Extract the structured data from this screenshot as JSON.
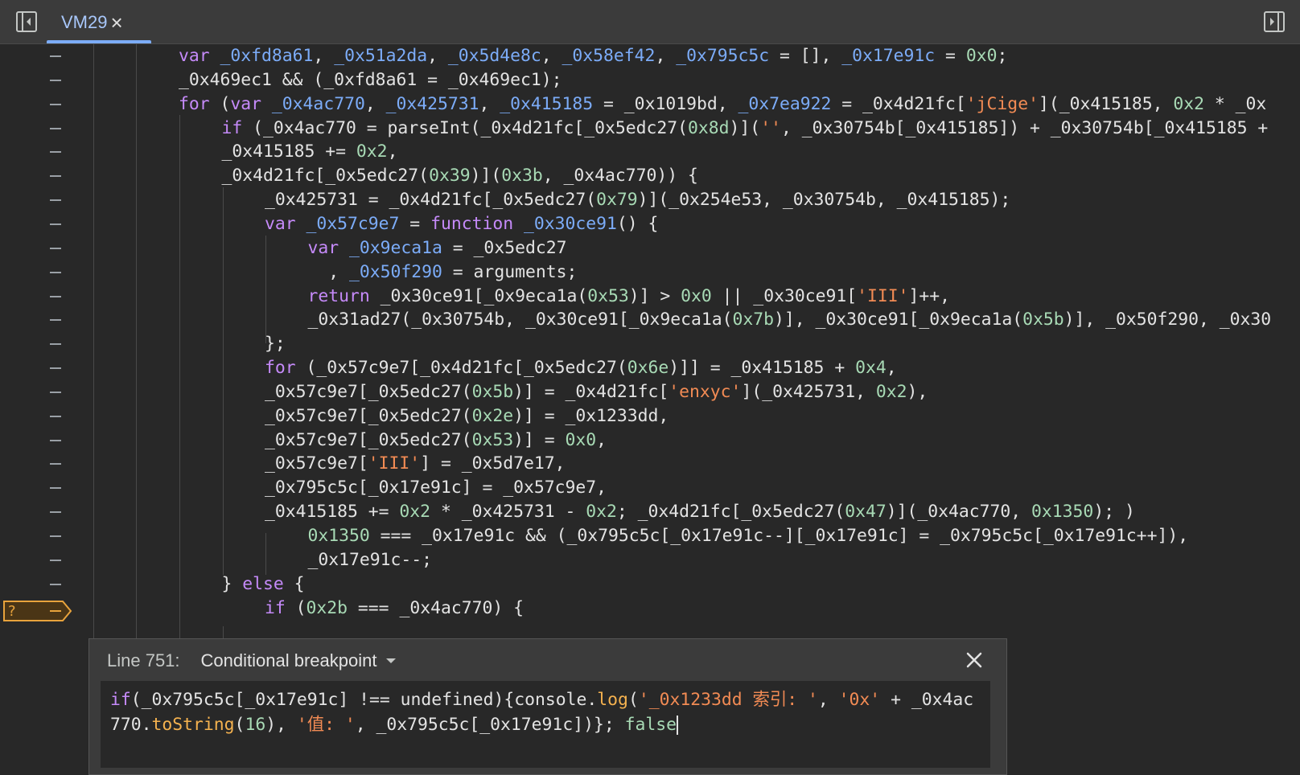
{
  "tab": {
    "title": "VM29",
    "close": "×"
  },
  "editor": {
    "lines": [
      {
        "indent": 0,
        "tokens": [
          [
            "k",
            "var "
          ],
          [
            "v",
            "_0xfd8a61"
          ],
          [
            "p",
            ", "
          ],
          [
            "v",
            "_0x51a2da"
          ],
          [
            "p",
            ", "
          ],
          [
            "v",
            "_0x5d4e8c"
          ],
          [
            "p",
            ", "
          ],
          [
            "v",
            "_0x58ef42"
          ],
          [
            "p",
            ", "
          ],
          [
            "v",
            "_0x795c5c"
          ],
          [
            "p",
            " = [], "
          ],
          [
            "v",
            "_0x17e91c"
          ],
          [
            "p",
            " = "
          ],
          [
            "n",
            "0x0"
          ],
          [
            "p",
            ";"
          ]
        ]
      },
      {
        "indent": 0,
        "tokens": [
          [
            "p",
            "_0x469ec1 && (_0xfd8a61 = _0x469ec1);"
          ]
        ]
      },
      {
        "indent": 0,
        "tokens": [
          [
            "k",
            "for "
          ],
          [
            "p",
            "("
          ],
          [
            "k",
            "var "
          ],
          [
            "v",
            "_0x4ac770"
          ],
          [
            "p",
            ", "
          ],
          [
            "v",
            "_0x425731"
          ],
          [
            "p",
            ", "
          ],
          [
            "v",
            "_0x415185"
          ],
          [
            "p",
            " = _0x1019bd, "
          ],
          [
            "v",
            "_0x7ea922"
          ],
          [
            "p",
            " = _0x4d21fc["
          ],
          [
            "s",
            "'jCige'"
          ],
          [
            "p",
            "](_0x415185, "
          ],
          [
            "n",
            "0x2"
          ],
          [
            "p",
            " * _0x"
          ]
        ]
      },
      {
        "indent": 1,
        "tokens": [
          [
            "k",
            "if "
          ],
          [
            "p",
            "(_0x4ac770 = parseInt(_0x4d21fc[_0x5edc27("
          ],
          [
            "n",
            "0x8d"
          ],
          [
            "p",
            ")]("
          ],
          [
            "s",
            "''"
          ],
          [
            "p",
            ", _0x30754b[_0x415185]) + _0x30754b[_0x415185 + "
          ]
        ]
      },
      {
        "indent": 1,
        "tokens": [
          [
            "p",
            "_0x415185 += "
          ],
          [
            "n",
            "0x2"
          ],
          [
            "p",
            ","
          ]
        ]
      },
      {
        "indent": 1,
        "tokens": [
          [
            "p",
            "_0x4d21fc[_0x5edc27("
          ],
          [
            "n",
            "0x39"
          ],
          [
            "p",
            ")]("
          ],
          [
            "n",
            "0x3b"
          ],
          [
            "p",
            ", _0x4ac770)) {"
          ]
        ]
      },
      {
        "indent": 2,
        "tokens": [
          [
            "p",
            "_0x425731 = _0x4d21fc[_0x5edc27("
          ],
          [
            "n",
            "0x79"
          ],
          [
            "p",
            ")](_0x254e53, _0x30754b, _0x415185);"
          ]
        ]
      },
      {
        "indent": 2,
        "tokens": [
          [
            "k",
            "var "
          ],
          [
            "v",
            "_0x57c9e7"
          ],
          [
            "p",
            " = "
          ],
          [
            "k",
            "function "
          ],
          [
            "v",
            "_0x30ce91"
          ],
          [
            "p",
            "() {"
          ]
        ]
      },
      {
        "indent": 3,
        "tokens": [
          [
            "k",
            "var "
          ],
          [
            "v",
            "_0x9eca1a"
          ],
          [
            "p",
            " = _0x5edc27"
          ]
        ]
      },
      {
        "indent": 3,
        "tokens": [
          [
            "p",
            "  , "
          ],
          [
            "v",
            "_0x50f290"
          ],
          [
            "p",
            " = arguments;"
          ]
        ]
      },
      {
        "indent": 3,
        "tokens": [
          [
            "k",
            "return "
          ],
          [
            "p",
            "_0x30ce91[_0x9eca1a("
          ],
          [
            "n",
            "0x53"
          ],
          [
            "p",
            ")] > "
          ],
          [
            "n",
            "0x0"
          ],
          [
            "p",
            " || _0x30ce91["
          ],
          [
            "s",
            "'III'"
          ],
          [
            "p",
            "]++,"
          ]
        ]
      },
      {
        "indent": 3,
        "tokens": [
          [
            "p",
            "_0x31ad27(_0x30754b, _0x30ce91[_0x9eca1a("
          ],
          [
            "n",
            "0x7b"
          ],
          [
            "p",
            ")], _0x30ce91[_0x9eca1a("
          ],
          [
            "n",
            "0x5b"
          ],
          [
            "p",
            ")], _0x50f290, _0x30"
          ]
        ]
      },
      {
        "indent": 2,
        "tokens": [
          [
            "p",
            "};"
          ]
        ]
      },
      {
        "indent": 2,
        "tokens": [
          [
            "k",
            "for "
          ],
          [
            "p",
            "(_0x57c9e7[_0x4d21fc[_0x5edc27("
          ],
          [
            "n",
            "0x6e"
          ],
          [
            "p",
            ")]] = _0x415185 + "
          ],
          [
            "n",
            "0x4"
          ],
          [
            "p",
            ","
          ]
        ]
      },
      {
        "indent": 2,
        "tokens": [
          [
            "p",
            "_0x57c9e7[_0x5edc27("
          ],
          [
            "n",
            "0x5b"
          ],
          [
            "p",
            ")] = _0x4d21fc["
          ],
          [
            "s",
            "'enxyc'"
          ],
          [
            "p",
            "](_0x425731, "
          ],
          [
            "n",
            "0x2"
          ],
          [
            "p",
            "),"
          ]
        ]
      },
      {
        "indent": 2,
        "tokens": [
          [
            "p",
            "_0x57c9e7[_0x5edc27("
          ],
          [
            "n",
            "0x2e"
          ],
          [
            "p",
            ")] = _0x1233dd,"
          ]
        ]
      },
      {
        "indent": 2,
        "tokens": [
          [
            "p",
            "_0x57c9e7[_0x5edc27("
          ],
          [
            "n",
            "0x53"
          ],
          [
            "p",
            ")] = "
          ],
          [
            "n",
            "0x0"
          ],
          [
            "p",
            ","
          ]
        ]
      },
      {
        "indent": 2,
        "tokens": [
          [
            "p",
            "_0x57c9e7["
          ],
          [
            "s",
            "'III'"
          ],
          [
            "p",
            "] = _0x5d7e17,"
          ]
        ]
      },
      {
        "indent": 2,
        "tokens": [
          [
            "p",
            "_0x795c5c[_0x17e91c] = _0x57c9e7,"
          ]
        ]
      },
      {
        "indent": 2,
        "tokens": [
          [
            "p",
            "_0x415185 += "
          ],
          [
            "n",
            "0x2"
          ],
          [
            "p",
            " * _0x425731 - "
          ],
          [
            "n",
            "0x2"
          ],
          [
            "p",
            "; _0x4d21fc[_0x5edc27("
          ],
          [
            "n",
            "0x47"
          ],
          [
            "p",
            ")](_0x4ac770, "
          ],
          [
            "n",
            "0x1350"
          ],
          [
            "p",
            "); )"
          ]
        ]
      },
      {
        "indent": 3,
        "tokens": [
          [
            "n",
            "0x1350"
          ],
          [
            "p",
            " === _0x17e91c && (_0x795c5c[_0x17e91c--][_0x17e91c] = _0x795c5c[_0x17e91c++]),"
          ]
        ]
      },
      {
        "indent": 3,
        "tokens": [
          [
            "p",
            "_0x17e91c--;"
          ]
        ]
      },
      {
        "indent": 1,
        "tokens": [
          [
            "p",
            "} "
          ],
          [
            "k",
            "else"
          ],
          [
            "p",
            " {"
          ]
        ]
      },
      {
        "indent": 2,
        "tokens": [
          [
            "k",
            "if "
          ],
          [
            "p",
            "("
          ],
          [
            "n",
            "0x2b"
          ],
          [
            "p",
            " === _0x4ac770) {"
          ]
        ]
      }
    ],
    "breakpoint_marker": "?"
  },
  "breakpoint_editor": {
    "line_label": "Line 751:",
    "type": "Conditional breakpoint",
    "condition_tokens": [
      [
        "k",
        "if"
      ],
      [
        "p",
        "(_0x795c5c[_0x17e91c] !== undefined){console."
      ],
      [
        "f",
        "log"
      ],
      [
        "p",
        "("
      ],
      [
        "s",
        "'_0x1233dd 索引: '"
      ],
      [
        "p",
        ", "
      ],
      [
        "s",
        "'0x'"
      ],
      [
        "p",
        " + _0x4ac770."
      ],
      [
        "f",
        "toString"
      ],
      [
        "p",
        "("
      ],
      [
        "n",
        "16"
      ],
      [
        "p",
        "), "
      ],
      [
        "s",
        "'值: '"
      ],
      [
        "p",
        ", _0x795c5c[_0x17e91c])}; "
      ],
      [
        "n",
        "false"
      ]
    ]
  },
  "colors": {
    "keyword": "#c58af9",
    "variable": "#7cacf8",
    "string": "#f28b54",
    "number": "#a8dab5",
    "function": "#f5b24f",
    "breakpoint": "#e8a33c"
  }
}
